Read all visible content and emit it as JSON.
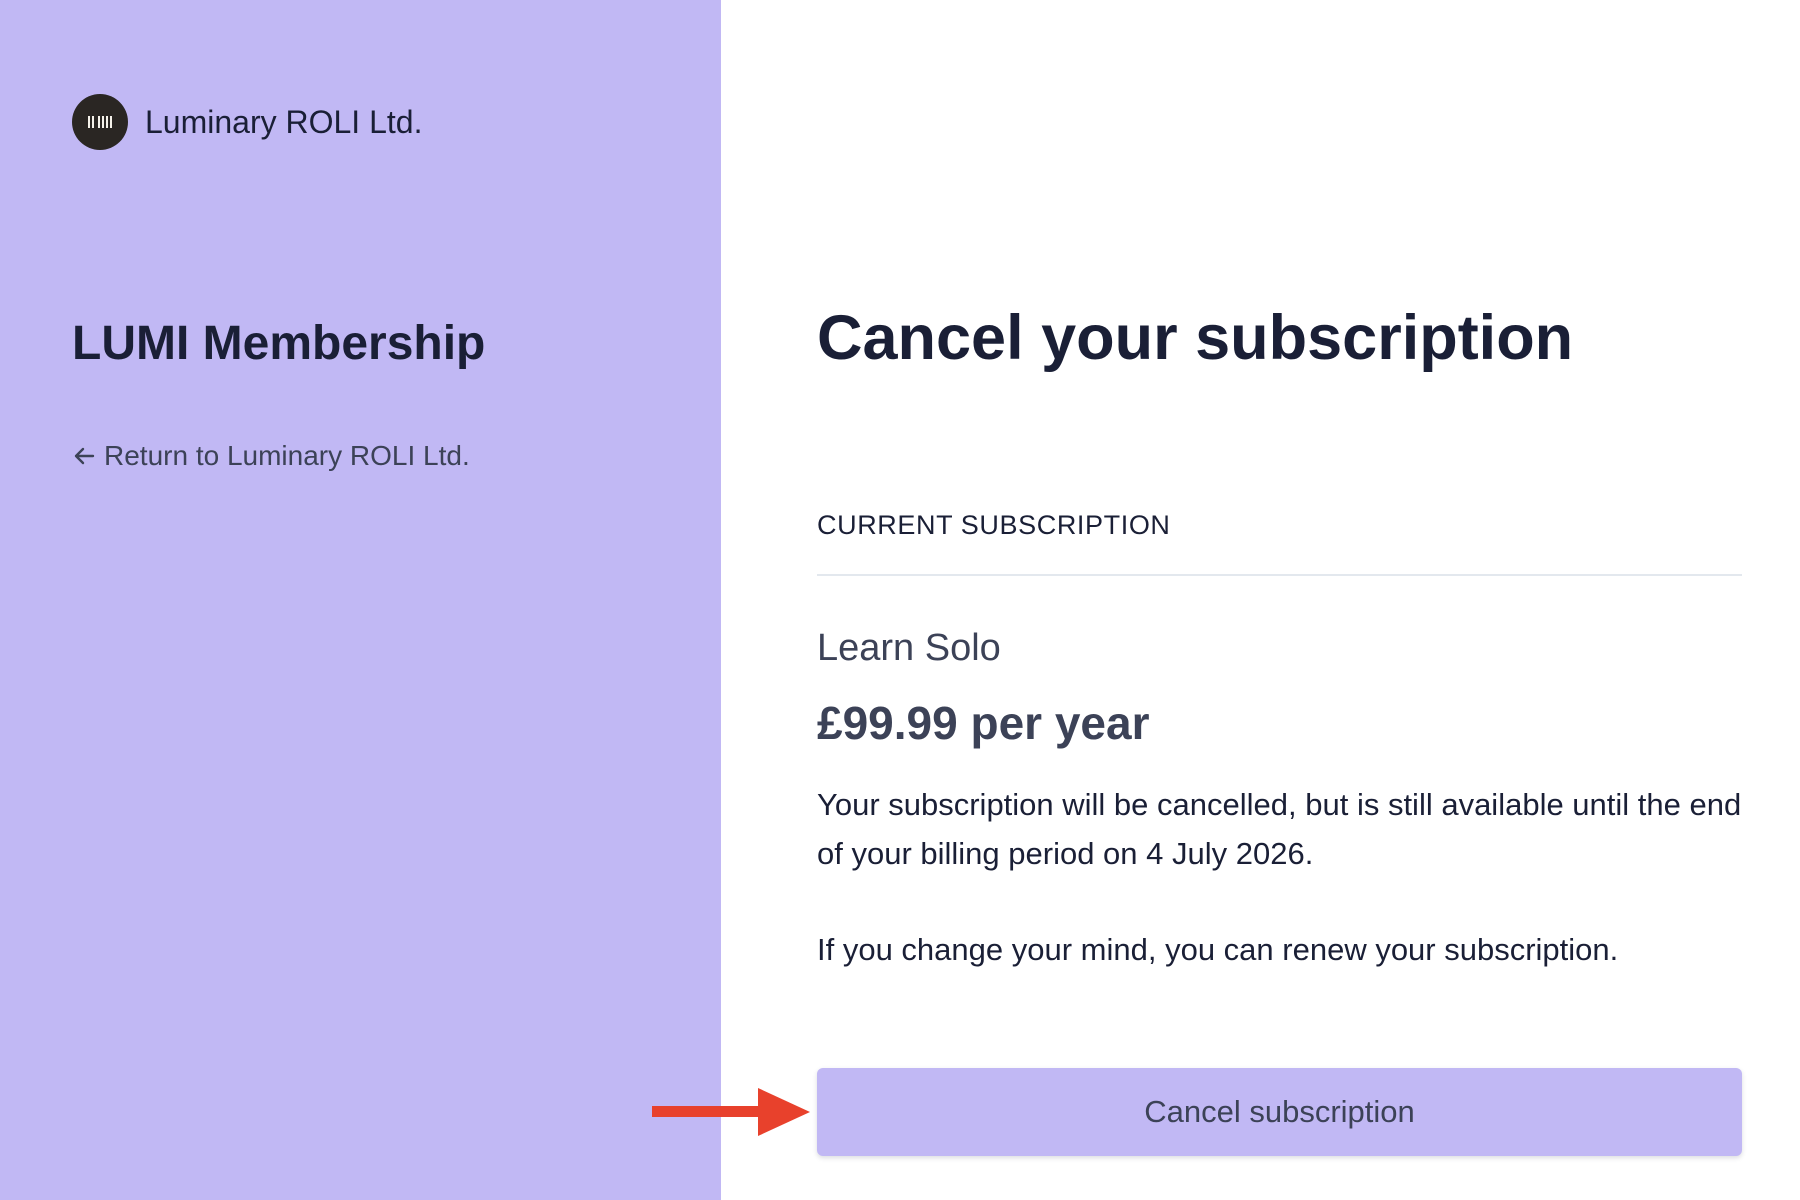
{
  "brand": {
    "name": "Luminary ROLI Ltd.",
    "logo_icon": "barcode-logo-icon"
  },
  "sidebar": {
    "product_name": "LUMI Membership",
    "return_link": "Return to Luminary ROLI Ltd.",
    "return_icon": "arrow-left-icon"
  },
  "main": {
    "title": "Cancel your subscription",
    "section_label": "CURRENT SUBSCRIPTION",
    "plan_name": "Learn Solo",
    "plan_price": "£99.99 per year",
    "notice": "Your subscription will be cancelled, but is still available until the end of your billing period on 4 July 2026.",
    "renew_note": "If you change your mind, you can renew your subscription.",
    "cancel_button": "Cancel subscription"
  },
  "colors": {
    "sidebar_background": "#c1b8f4",
    "button_background": "#c1b8f4",
    "text_primary": "#1a1f36",
    "text_secondary": "#3c4257",
    "annotation_arrow": "#e8412c"
  }
}
